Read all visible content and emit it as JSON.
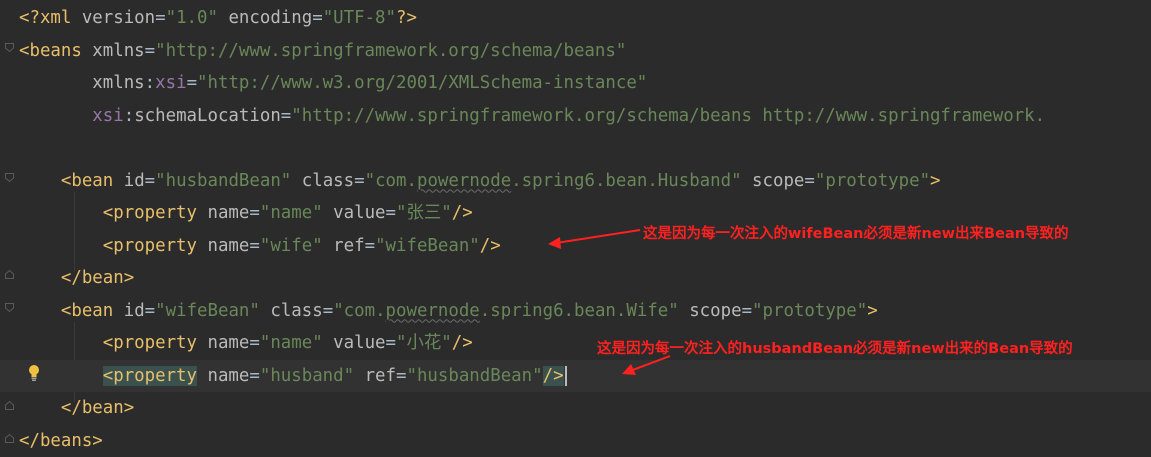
{
  "editor": {
    "language": "xml",
    "lines": [
      {
        "tokens": [
          [
            "pi",
            "<?xml "
          ],
          [
            "attr",
            "version"
          ],
          [
            "plain",
            "="
          ],
          [
            "val",
            "\"1.0\""
          ],
          [
            "plain",
            " "
          ],
          [
            "attr",
            "encoding"
          ],
          [
            "plain",
            "="
          ],
          [
            "val",
            "\"UTF-8\""
          ],
          [
            "pi",
            "?>"
          ]
        ]
      },
      {
        "tokens": [
          [
            "tag",
            "<beans "
          ],
          [
            "attr",
            "xmlns"
          ],
          [
            "plain",
            "="
          ],
          [
            "val",
            "\"http://www.springframework.org/schema/beans\""
          ]
        ]
      },
      {
        "tokens": [
          [
            "plain",
            "       "
          ],
          [
            "attr",
            "xmlns"
          ],
          [
            "plain",
            ":"
          ],
          [
            "ns",
            "xsi"
          ],
          [
            "plain",
            "="
          ],
          [
            "val",
            "\"http://www.w3.org/2001/XMLSchema-instance\""
          ]
        ]
      },
      {
        "tokens": [
          [
            "plain",
            "       "
          ],
          [
            "ns",
            "xsi"
          ],
          [
            "plain",
            ":"
          ],
          [
            "attr",
            "schemaLocation"
          ],
          [
            "plain",
            "="
          ],
          [
            "val",
            "\"http://www.springframework.org/schema/beans http://www.springframework."
          ]
        ]
      },
      {
        "tokens": []
      },
      {
        "tokens": [
          [
            "plain",
            "    "
          ],
          [
            "tag",
            "<bean "
          ],
          [
            "attr",
            "id"
          ],
          [
            "plain",
            "="
          ],
          [
            "val",
            "\"husbandBean\""
          ],
          [
            "plain",
            " "
          ],
          [
            "attr",
            "class"
          ],
          [
            "plain",
            "="
          ],
          [
            "val",
            "\"com."
          ],
          [
            "val squig",
            "powernode"
          ],
          [
            "val",
            ".spring6.bean.Husband\""
          ],
          [
            "plain",
            " "
          ],
          [
            "attr",
            "scope"
          ],
          [
            "plain",
            "="
          ],
          [
            "val",
            "\"prototype\""
          ],
          [
            "tag",
            ">"
          ]
        ]
      },
      {
        "tokens": [
          [
            "plain",
            "        "
          ],
          [
            "tag",
            "<property "
          ],
          [
            "attr",
            "name"
          ],
          [
            "plain",
            "="
          ],
          [
            "val",
            "\"name\""
          ],
          [
            "plain",
            " "
          ],
          [
            "attr",
            "value"
          ],
          [
            "plain",
            "="
          ],
          [
            "val",
            "\"张三\""
          ],
          [
            "tag",
            "/>"
          ]
        ]
      },
      {
        "tokens": [
          [
            "plain",
            "        "
          ],
          [
            "tag",
            "<property "
          ],
          [
            "attr",
            "name"
          ],
          [
            "plain",
            "="
          ],
          [
            "val",
            "\"wife\""
          ],
          [
            "plain",
            " "
          ],
          [
            "attr",
            "ref"
          ],
          [
            "plain",
            "="
          ],
          [
            "val",
            "\"wifeBean\""
          ],
          [
            "tag",
            "/>"
          ]
        ]
      },
      {
        "tokens": [
          [
            "plain",
            "    "
          ],
          [
            "tag",
            "</bean>"
          ]
        ]
      },
      {
        "tokens": [
          [
            "plain",
            "    "
          ],
          [
            "tag",
            "<bean "
          ],
          [
            "attr",
            "id"
          ],
          [
            "plain",
            "="
          ],
          [
            "val",
            "\"wifeBean\""
          ],
          [
            "plain",
            " "
          ],
          [
            "attr",
            "class"
          ],
          [
            "plain",
            "="
          ],
          [
            "val",
            "\"com."
          ],
          [
            "val squig",
            "powernode"
          ],
          [
            "val",
            ".spring6.bean.Wife\""
          ],
          [
            "plain",
            " "
          ],
          [
            "attr",
            "scope"
          ],
          [
            "plain",
            "="
          ],
          [
            "val",
            "\"prototype\""
          ],
          [
            "tag",
            ">"
          ]
        ]
      },
      {
        "tokens": [
          [
            "plain",
            "        "
          ],
          [
            "tag",
            "<property "
          ],
          [
            "attr",
            "name"
          ],
          [
            "plain",
            "="
          ],
          [
            "val",
            "\"name\""
          ],
          [
            "plain",
            " "
          ],
          [
            "attr",
            "value"
          ],
          [
            "plain",
            "="
          ],
          [
            "val",
            "\"小花\""
          ],
          [
            "tag",
            "/>"
          ]
        ]
      },
      {
        "tokens": [
          [
            "plain",
            "        "
          ],
          [
            "tag tag-hl",
            "<property"
          ],
          [
            "tag",
            " "
          ],
          [
            "attr",
            "name"
          ],
          [
            "plain",
            "="
          ],
          [
            "val",
            "\"husband\""
          ],
          [
            "plain",
            " "
          ],
          [
            "attr",
            "ref"
          ],
          [
            "plain",
            "="
          ],
          [
            "val",
            "\"husbandBean\""
          ],
          [
            "tag brace-hl",
            "/>"
          ],
          [
            "caret",
            ""
          ]
        ]
      },
      {
        "tokens": [
          [
            "plain",
            "    "
          ],
          [
            "tag",
            "</bean>"
          ]
        ]
      },
      {
        "tokens": [
          [
            "tag",
            "</beans>"
          ]
        ]
      }
    ]
  },
  "annotations": [
    {
      "text": "这是因为每一次注入的wifeBean必须是新new出来Bean导致的",
      "color": "#ff2020"
    },
    {
      "text": "这是因为每一次注入的husbandBean必须是新new出来的Bean导致的",
      "color": "#ff2020"
    }
  ],
  "icons": {
    "intention": "lightbulb-icon",
    "fold": "fold-marker-icon"
  },
  "colors": {
    "background": "#2b2b2b",
    "tag": "#e8bf6a",
    "attribute": "#bababa",
    "namespace": "#9876aa",
    "value": "#6a8759",
    "annotation": "#ff2020"
  }
}
